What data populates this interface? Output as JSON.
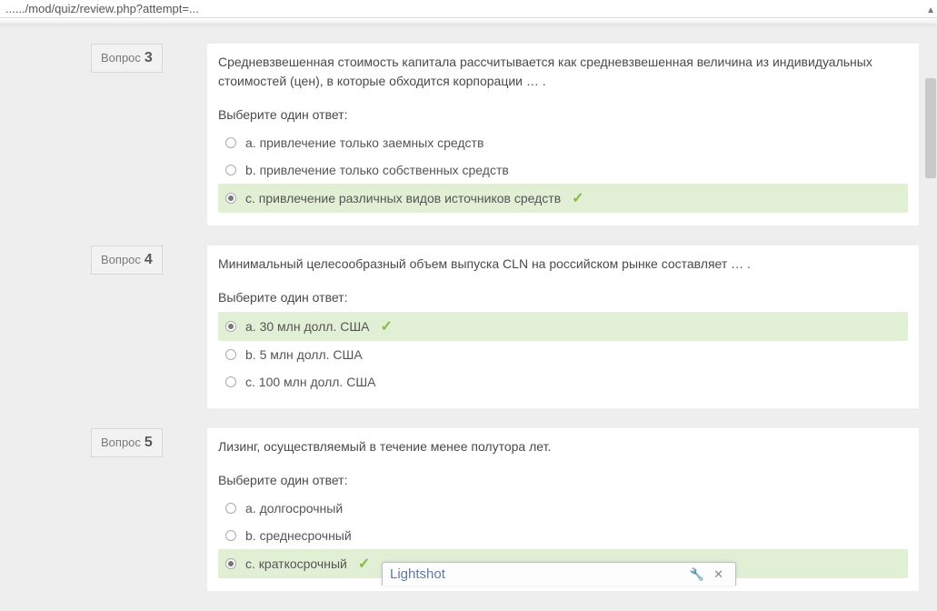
{
  "url_fragment": "....../mod/quiz/review.php?attempt=...",
  "question_label": "Вопрос",
  "choose_one": "Выберите один ответ:",
  "popup": {
    "title": "Lightshot"
  },
  "questions": [
    {
      "number": "3",
      "text": "Средневзвешенная стоимость капитала рассчитывается как средневзвешенная величина из индивидуальных стоимостей (цен), в которые обходится корпорации … .",
      "answers": [
        {
          "label": "a. привлечение только заемных средств",
          "selected": false,
          "correct": false
        },
        {
          "label": "b. привлечение только собственных средств",
          "selected": false,
          "correct": false
        },
        {
          "label": "c. привлечение различных видов источников средств",
          "selected": true,
          "correct": true
        }
      ]
    },
    {
      "number": "4",
      "text": "Минимальный целесообразный объем выпуска CLN на российском рынке составляет … .",
      "answers": [
        {
          "label": "a. 30 млн долл. США",
          "selected": true,
          "correct": true
        },
        {
          "label": "b. 5 млн долл. США",
          "selected": false,
          "correct": false
        },
        {
          "label": "c. 100 млн долл. США",
          "selected": false,
          "correct": false
        }
      ]
    },
    {
      "number": "5",
      "text": "Лизинг, осуществляемый в течение менее полутора лет.",
      "answers": [
        {
          "label": "a. долгосрочный",
          "selected": false,
          "correct": false
        },
        {
          "label": "b. среднесрочный",
          "selected": false,
          "correct": false
        },
        {
          "label": "c. краткосрочный",
          "selected": true,
          "correct": true
        }
      ]
    }
  ]
}
